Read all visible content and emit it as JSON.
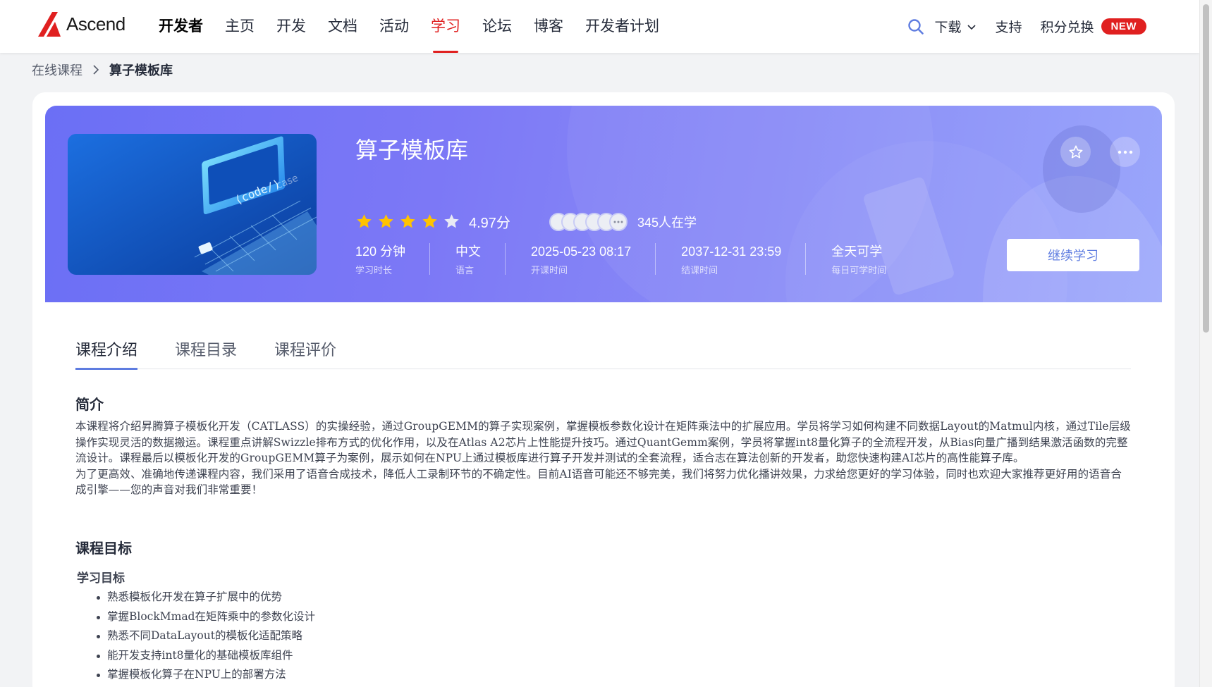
{
  "header": {
    "logo_text": "Ascend",
    "brand_label": "开发者",
    "nav": [
      "主页",
      "开发",
      "文档",
      "活动",
      "学习",
      "论坛",
      "博客",
      "开发者计划"
    ],
    "active_nav": "学习",
    "download_label": "下载",
    "support_label": "支持",
    "points_label": "积分兑换",
    "new_badge": "NEW",
    "accent_color": "#e02020"
  },
  "breadcrumb": {
    "parent": "在线课程",
    "current": "算子模板库"
  },
  "course": {
    "title": "算子模板库",
    "thumb_code": "⟨code/⟩",
    "thumb_case": "case",
    "rating": 4.97,
    "rating_text": "4.97分",
    "learners_text": "345人在学",
    "stats": [
      {
        "value": "120 分钟",
        "label": "学习时长"
      },
      {
        "value": "中文",
        "label": "语言"
      },
      {
        "value": "2025-05-23 08:17",
        "label": "开课时间"
      },
      {
        "value": "2037-12-31 23:59",
        "label": "结课时间"
      },
      {
        "value": "全天可学",
        "label": "每日可学时间"
      }
    ],
    "continue_label": "继续学习"
  },
  "tabs": [
    "课程介绍",
    "课程目录",
    "课程评价"
  ],
  "intro": {
    "title": "简介",
    "p1": "本课程将介绍昇腾算子模板化开发（CATLASS）的实操经验，通过GroupGEMM的算子实现案例，掌握模板参数化设计在矩阵乘法中的扩展应用。学员将学习如何构建不同数据Layout的Matmul内核，通过Tile层级操作实现灵活的数据搬运。课程重点讲解Swizzle排布方式的优化作用，以及在Atlas A2芯片上性能提升技巧。通过QuantGemm案例，学员将掌握int8量化算子的全流程开发，从Bias向量广播到结果激活函数的完整流设计。课程最后以模板化开发的GroupGEMM算子为案例，展示如何在NPU上通过模板库进行算子开发并测试的全套流程，适合志在算法创新的开发者，助您快速构建AI芯片的高性能算子库。",
    "p2": "为了更高效、准确地传递课程内容，我们采用了语音合成技术，降低人工录制环节的不确定性。目前AI语音可能还不够完美，我们将努力优化播讲效果，力求给您更好的学习体验，同时也欢迎大家推荐更好用的语音合成引擎——您的声音对我们非常重要！"
  },
  "goals": {
    "title": "课程目标",
    "subtitle": "学习目标",
    "items": [
      "熟悉模板化开发在算子扩展中的优势",
      "掌握BlockMmad在矩阵乘中的参数化设计",
      "熟悉不同DataLayout的模板化适配策略",
      "能开发支持int8量化的基础模板库组件",
      "掌握模板化算子在NPU上的部署方法"
    ]
  }
}
